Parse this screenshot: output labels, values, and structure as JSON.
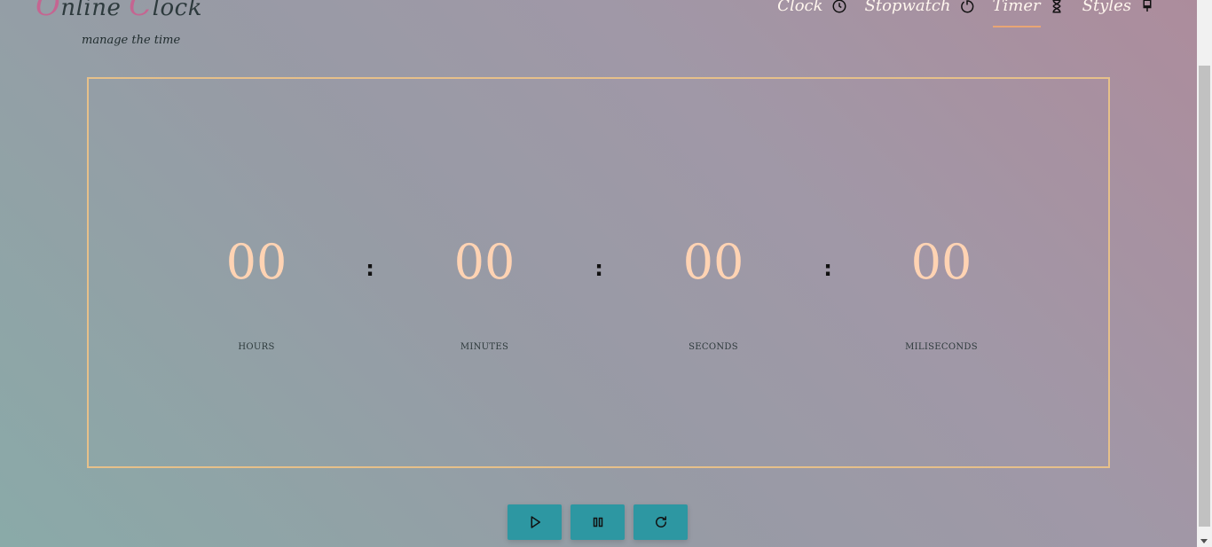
{
  "header": {
    "logo_word1_cap": "O",
    "logo_word1_rest": "nline ",
    "logo_word2_cap": "C",
    "logo_word2_rest": "lock",
    "tagline": "manage the time"
  },
  "nav": {
    "items": [
      {
        "label": "Clock",
        "icon": "clock-icon"
      },
      {
        "label": "Stopwatch",
        "icon": "stopwatch-icon"
      },
      {
        "label": "Timer",
        "icon": "hourglass-icon",
        "active": true
      },
      {
        "label": "Styles",
        "icon": "brush-icon"
      }
    ]
  },
  "timer": {
    "hours": "00",
    "minutes": "00",
    "seconds": "00",
    "milliseconds": "00",
    "hours_label": "HOURS",
    "minutes_label": "MINUTES",
    "seconds_label": "SECONDS",
    "milliseconds_label": "MILISECONDS",
    "separator": ":"
  },
  "controls": {
    "play": "play-icon",
    "pause": "pause-icon",
    "reset": "reset-icon"
  },
  "colors": {
    "accent": "#e8a574",
    "frame": "#e6c08a",
    "digits": "#ffd3b3",
    "button": "#2d97a2",
    "logo_cap": "#c56591"
  }
}
